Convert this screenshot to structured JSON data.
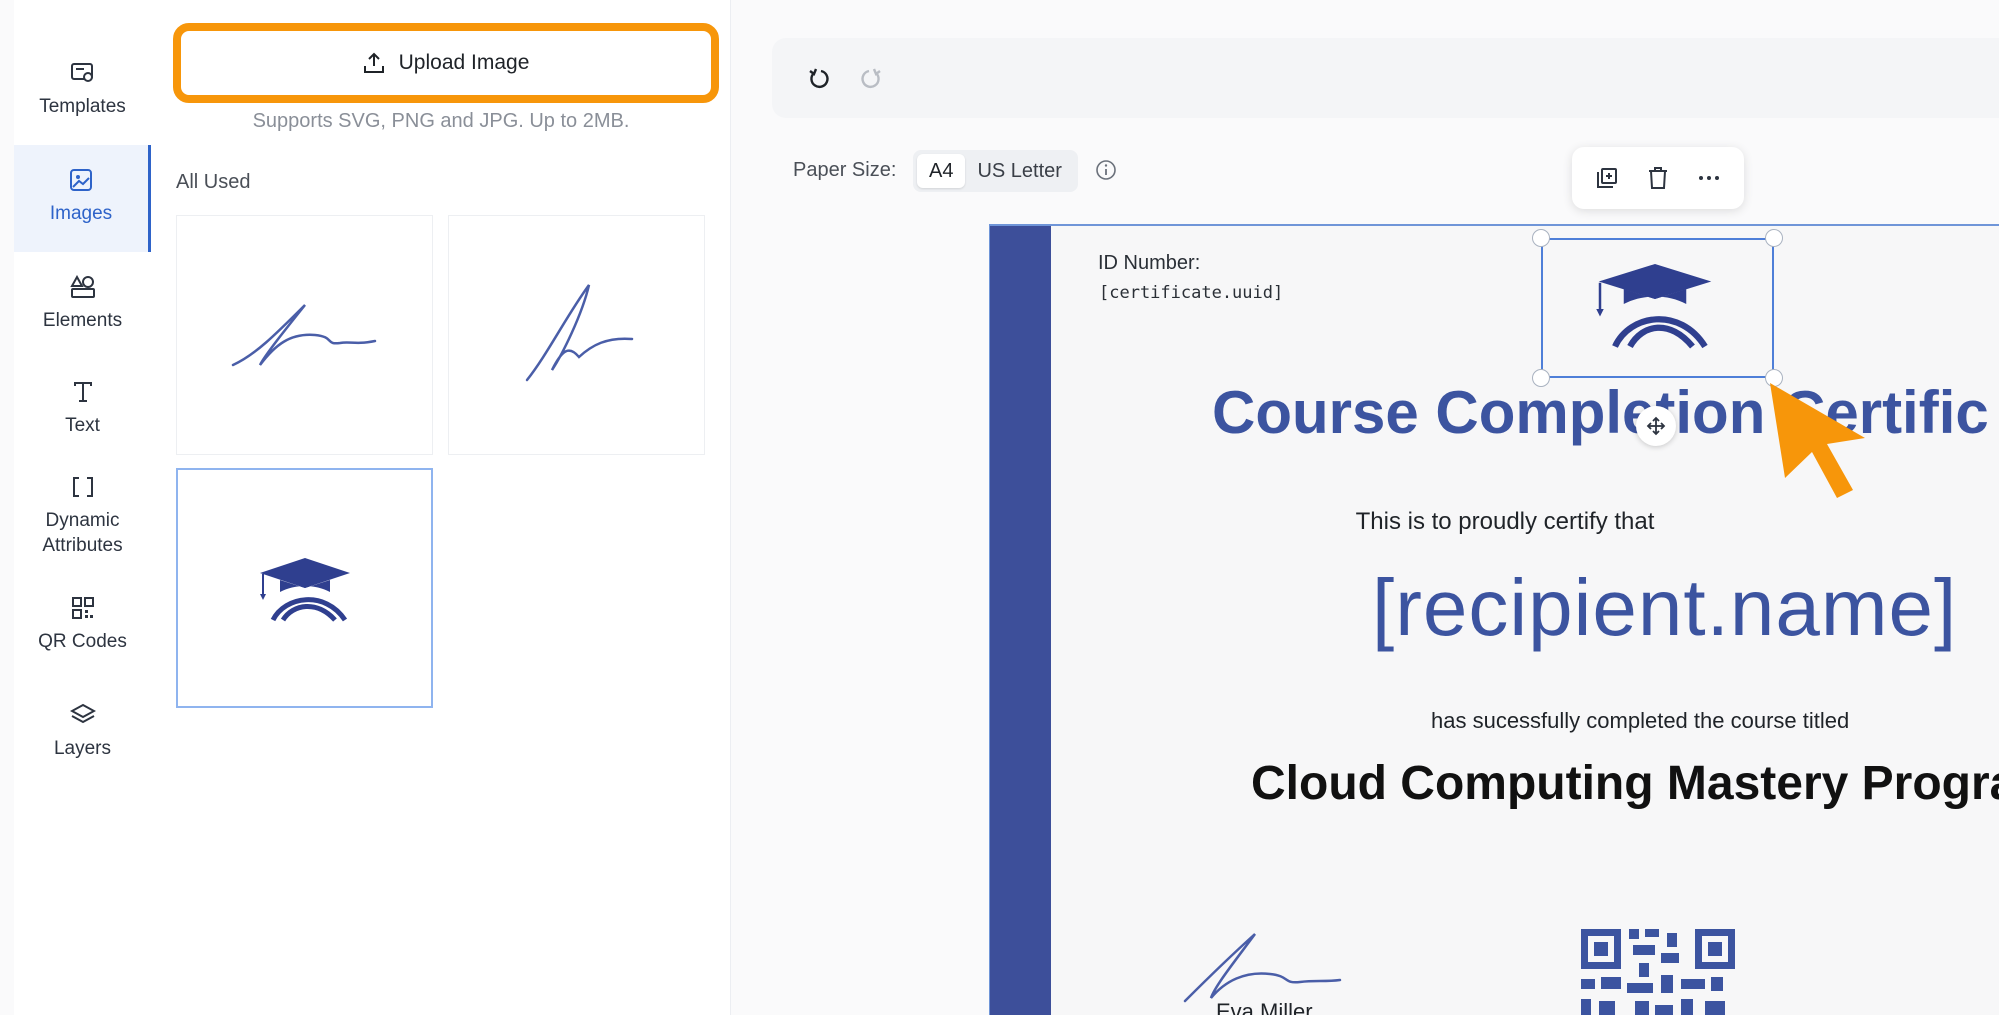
{
  "sidebar": {
    "items": [
      {
        "label": "Templates",
        "icon": "templates-icon"
      },
      {
        "label": "Images",
        "icon": "image-icon",
        "active": true
      },
      {
        "label": "Elements",
        "icon": "shapes-icon"
      },
      {
        "label": "Text",
        "icon": "text-icon"
      },
      {
        "label": "Dynamic Attributes",
        "icon": "brackets-icon"
      },
      {
        "label": "QR Codes",
        "icon": "qr-icon"
      },
      {
        "label": "Layers",
        "icon": "layers-icon"
      }
    ]
  },
  "panel": {
    "upload_label": "Upload Image",
    "upload_hint": "Supports SVG, PNG and JPG. Up to 2MB.",
    "section_title": "All Used",
    "thumbnails": [
      "signature-1",
      "signature-2",
      "graduation-cap-logo"
    ]
  },
  "toolbar": {
    "undo_icon": "undo-icon",
    "redo_icon": "redo-icon"
  },
  "paper": {
    "label": "Paper Size:",
    "options": [
      "A4",
      "US Letter"
    ],
    "selected": "A4"
  },
  "certificate": {
    "id_label": "ID Number:",
    "id_value": "[certificate.uuid]",
    "title": "Course Completion Certific",
    "proud_text": "This is to proudly certify that",
    "recipient": "[recipient.name]",
    "completed_text": "has sucessfully completed the course titled",
    "course": "Cloud Computing Mastery Progra",
    "signer": "Eva Miller"
  },
  "colors": {
    "accent": "#f7960a",
    "brand_blue": "#3c54a0",
    "selection": "#4f7fd8"
  }
}
